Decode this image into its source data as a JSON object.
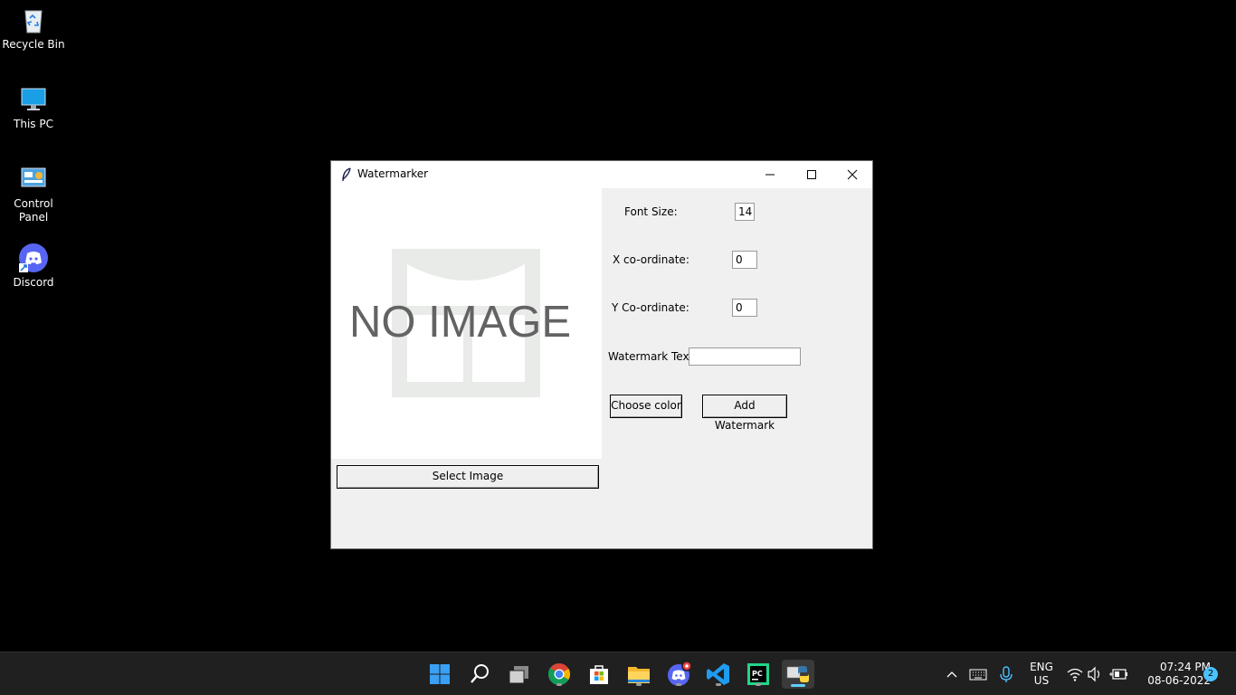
{
  "desktop": {
    "icons": [
      {
        "label": "Recycle Bin"
      },
      {
        "label": "This PC"
      },
      {
        "label": "Control Panel"
      },
      {
        "label": "Discord"
      }
    ]
  },
  "window": {
    "title": "Watermarker",
    "no_image_text": "NO IMAGE",
    "select_image_label": "Select Image",
    "font_size_label": "Font Size:",
    "font_size_value": "14",
    "x_label": "X co-ordinate:",
    "x_value": "0",
    "y_label": "Y Co-ordinate:",
    "y_value": "0",
    "watermark_text_label": "Watermark Text:",
    "watermark_text_value": "",
    "choose_color_label": "Choose color",
    "add_watermark_label": "Add Watermark"
  },
  "taskbar": {
    "apps": [
      {
        "icon": "windows-start-icon"
      },
      {
        "icon": "search-icon"
      },
      {
        "icon": "task-view-icon"
      },
      {
        "icon": "chrome-icon"
      },
      {
        "icon": "microsoft-store-icon"
      },
      {
        "icon": "file-explorer-icon"
      },
      {
        "icon": "discord-icon"
      },
      {
        "icon": "vscode-icon"
      },
      {
        "icon": "pycharm-icon"
      },
      {
        "icon": "python-icon"
      }
    ],
    "lang_line1": "ENG",
    "lang_line2": "US",
    "time": "07:24 PM",
    "date": "08-06-2022",
    "notification_count": "2"
  },
  "colors": {
    "accent": "#60cdff",
    "taskbar_bg": "#202020",
    "window_bg": "#f0f0f0"
  }
}
